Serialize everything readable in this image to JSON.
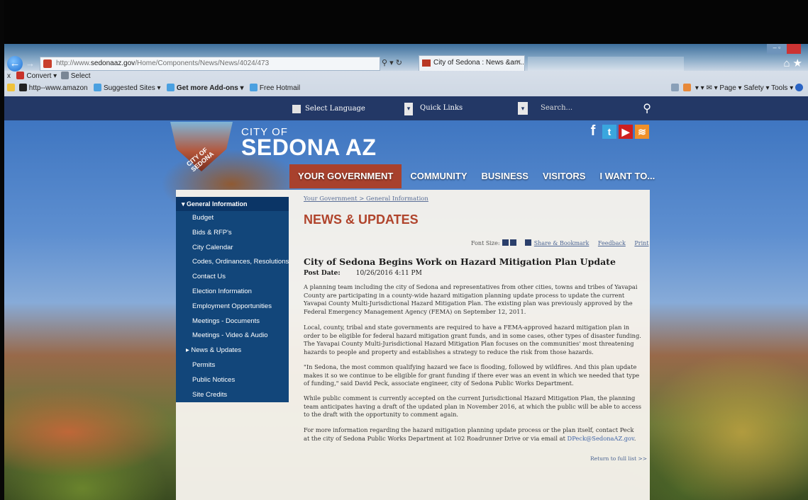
{
  "browser": {
    "address": {
      "prefix": "http://www.",
      "host": "sedonaaz.gov",
      "path": "/Home/Components/News/News/4024/473"
    },
    "addr_tools": "⚲ ▾ ↻",
    "tab_title": "City of Sedona : News &am...",
    "tab_close": "✕",
    "window_min": "– ▫",
    "home_star": "⌂★",
    "cmd1": {
      "close": "x",
      "convert": "Convert",
      "convert_arrow": "▾",
      "select": "Select"
    },
    "favorites": [
      {
        "label": "http--www.amazon",
        "icon": "amazon-icon",
        "color": "#222"
      },
      {
        "label": "Suggested Sites ▾",
        "icon": "ie-icon",
        "color": "#4aa0e0"
      },
      {
        "label": "Get more Add-ons ▾",
        "icon": "ie-icon",
        "color": "#4aa0e0"
      },
      {
        "label": "Free Hotmail",
        "icon": "ie-icon",
        "color": "#4aa0e0"
      }
    ],
    "toolbar_right": "▾  ▾ ✉  ▾ Page ▾  Safety ▾  Tools ▾"
  },
  "site": {
    "select_language": "Select Language",
    "quick_links": "Quick Links",
    "search_placeholder": "Search...",
    "dd_arrow": "▾",
    "search_icon": "⚲",
    "logo": {
      "line1": "CITY OF",
      "line2": "SEDONA AZ",
      "seal_text": "CITY OF SEDONA"
    },
    "social": {
      "fb": "f",
      "tw": "t",
      "yt": "▶",
      "rss": "≋"
    },
    "nav": [
      "YOUR GOVERNMENT",
      "COMMUNITY",
      "BUSINESS",
      "VISITORS",
      "I WANT TO..."
    ]
  },
  "sidebar": {
    "header": "▾ General Information",
    "items": [
      "Budget",
      "Bids & RFP's",
      "City Calendar",
      "Codes, Ordinances, Resolutions",
      "Contact Us",
      "Election Information",
      "Employment Opportunities",
      "Meetings - Documents",
      "Meetings - Video & Audio",
      "▸ News & Updates",
      "Permits",
      "Public Notices",
      "Site Credits"
    ]
  },
  "content": {
    "breadcrumb": "Your Government > General Information",
    "page_title": "NEWS & UPDATES",
    "font_size_label": "Font Size:",
    "share": "Share & Bookmark",
    "feedback": "Feedback",
    "print": "Print",
    "article_title": "City of Sedona Begins Work on Hazard Mitigation Plan Update",
    "post_date_label": "Post Date:",
    "post_date": "10/26/2016 4:11 PM",
    "p1": "A planning team including the city of Sedona and representatives from other cities, towns and tribes of Yavapai County are participating in a county-wide hazard mitigation planning update process to update the current Yavapai County Multi-Jurisdictional Hazard Mitigation Plan. The existing plan was previously approved by the Federal Emergency Management Agency (FEMA) on September 12, 2011.",
    "p2": "Local, county, tribal and state governments are required to have a FEMA-approved hazard mitigation plan in order to be eligible for federal hazard mitigation grant funds, and in some cases, other types of disaster funding. The Yavapai County Multi-Jurisdictional Hazard Mitigation Plan focuses on the communities' most threatening hazards to people and property and establishes a strategy to reduce the risk from those hazards.",
    "p3": "\"In Sedona, the most common qualifying hazard we face is flooding, followed by wildfires. And this plan update makes it so we continue to be eligible for grant funding if there ever was an event in which we needed that type of funding,\" said David Peck, associate engineer, city of Sedona Public Works Department.",
    "p4": "While public comment is currently accepted on the current Jurisdictional Hazard Mitigation Plan, the planning team anticipates having a draft of the updated plan in November 2016, at which the public will be able to access to the draft with the opportunity to comment again.",
    "p5": "For more information regarding the hazard mitigation planning update process or the plan itself, contact Peck at the city of Sedona Public Works Department at 102 Roadrunner Drive or via email at",
    "email": "DPeck@SedonaAZ.gov",
    "period": ".",
    "return_link": "Return to full list >>"
  }
}
